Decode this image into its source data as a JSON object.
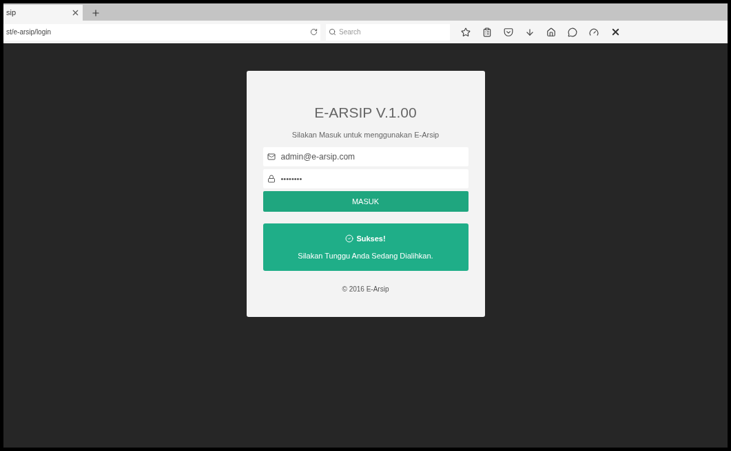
{
  "browser": {
    "tab": {
      "title": "sip",
      "selected": true
    },
    "url": "st/e-arsip/login",
    "search": {
      "placeholder": "Search"
    }
  },
  "login": {
    "title": "E-ARSIP V.1.00",
    "subtitle": "Silakan Masuk untuk menggunakan E-Arsip",
    "email": "admin@e-arsip.com",
    "password": "••••••••",
    "button": "MASUK",
    "alert": {
      "title": "Sukses!",
      "message": "Silakan Tunggu Anda Sedang Dialihkan."
    },
    "footer": "© 2016 E-Arsip"
  }
}
